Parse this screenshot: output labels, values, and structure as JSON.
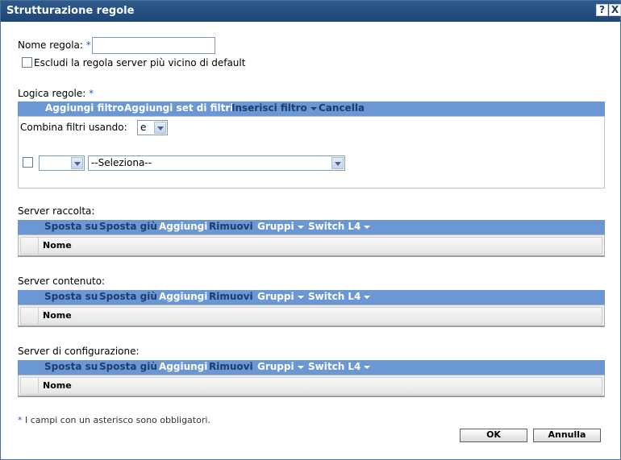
{
  "dialog": {
    "title": "Strutturazione regole",
    "help_label": "?",
    "close_label": "X"
  },
  "rule_name": {
    "label": "Nome regola:",
    "required_mark": "*",
    "value": ""
  },
  "exclude_default": {
    "label": "Escludi la regola server più vicino di default",
    "checked": false
  },
  "rule_logic": {
    "label": "Logica regole:",
    "required_mark": "*",
    "toolbar": {
      "add_filter": "Aggiungi filtro",
      "add_filter_set": "Aggiungi set di filtri",
      "insert_filter": "Inserisci filtro",
      "delete": "Cancella"
    },
    "combine_label": "Combina filtri usando:",
    "combine_value": "e",
    "filter_row": {
      "operator_value": "",
      "select_value": "--Seleziona--"
    }
  },
  "server_sections": [
    {
      "label": "Server raccolta:",
      "toolbar": {
        "move_up": "Sposta su",
        "move_down": "Sposta giù",
        "add": "Aggiungi",
        "remove": "Rimuovi",
        "groups": "Gruppi",
        "switch_l4": "Switch L4"
      },
      "column_name": "Nome"
    },
    {
      "label": "Server contenuto:",
      "toolbar": {
        "move_up": "Sposta su",
        "move_down": "Sposta giù",
        "add": "Aggiungi",
        "remove": "Rimuovi",
        "groups": "Gruppi",
        "switch_l4": "Switch L4"
      },
      "column_name": "Nome"
    },
    {
      "label": "Server di configurazione:",
      "toolbar": {
        "move_up": "Sposta su",
        "move_down": "Sposta giù",
        "add": "Aggiungi",
        "remove": "Rimuovi",
        "groups": "Gruppi",
        "switch_l4": "Switch L4"
      },
      "column_name": "Nome"
    }
  ],
  "footer": {
    "required_mark": "*",
    "required_note": "I campi con un asterisco sono obbligatori.",
    "ok_label": "OK",
    "cancel_label": "Annulla"
  },
  "colors": {
    "titlebar": "#1d4676",
    "toolbar": "#6b98d4",
    "toolbar_enabled_text": "#ffffff",
    "toolbar_disabled_text": "#1c3d6e",
    "required_mark": "#2a5ab0"
  }
}
